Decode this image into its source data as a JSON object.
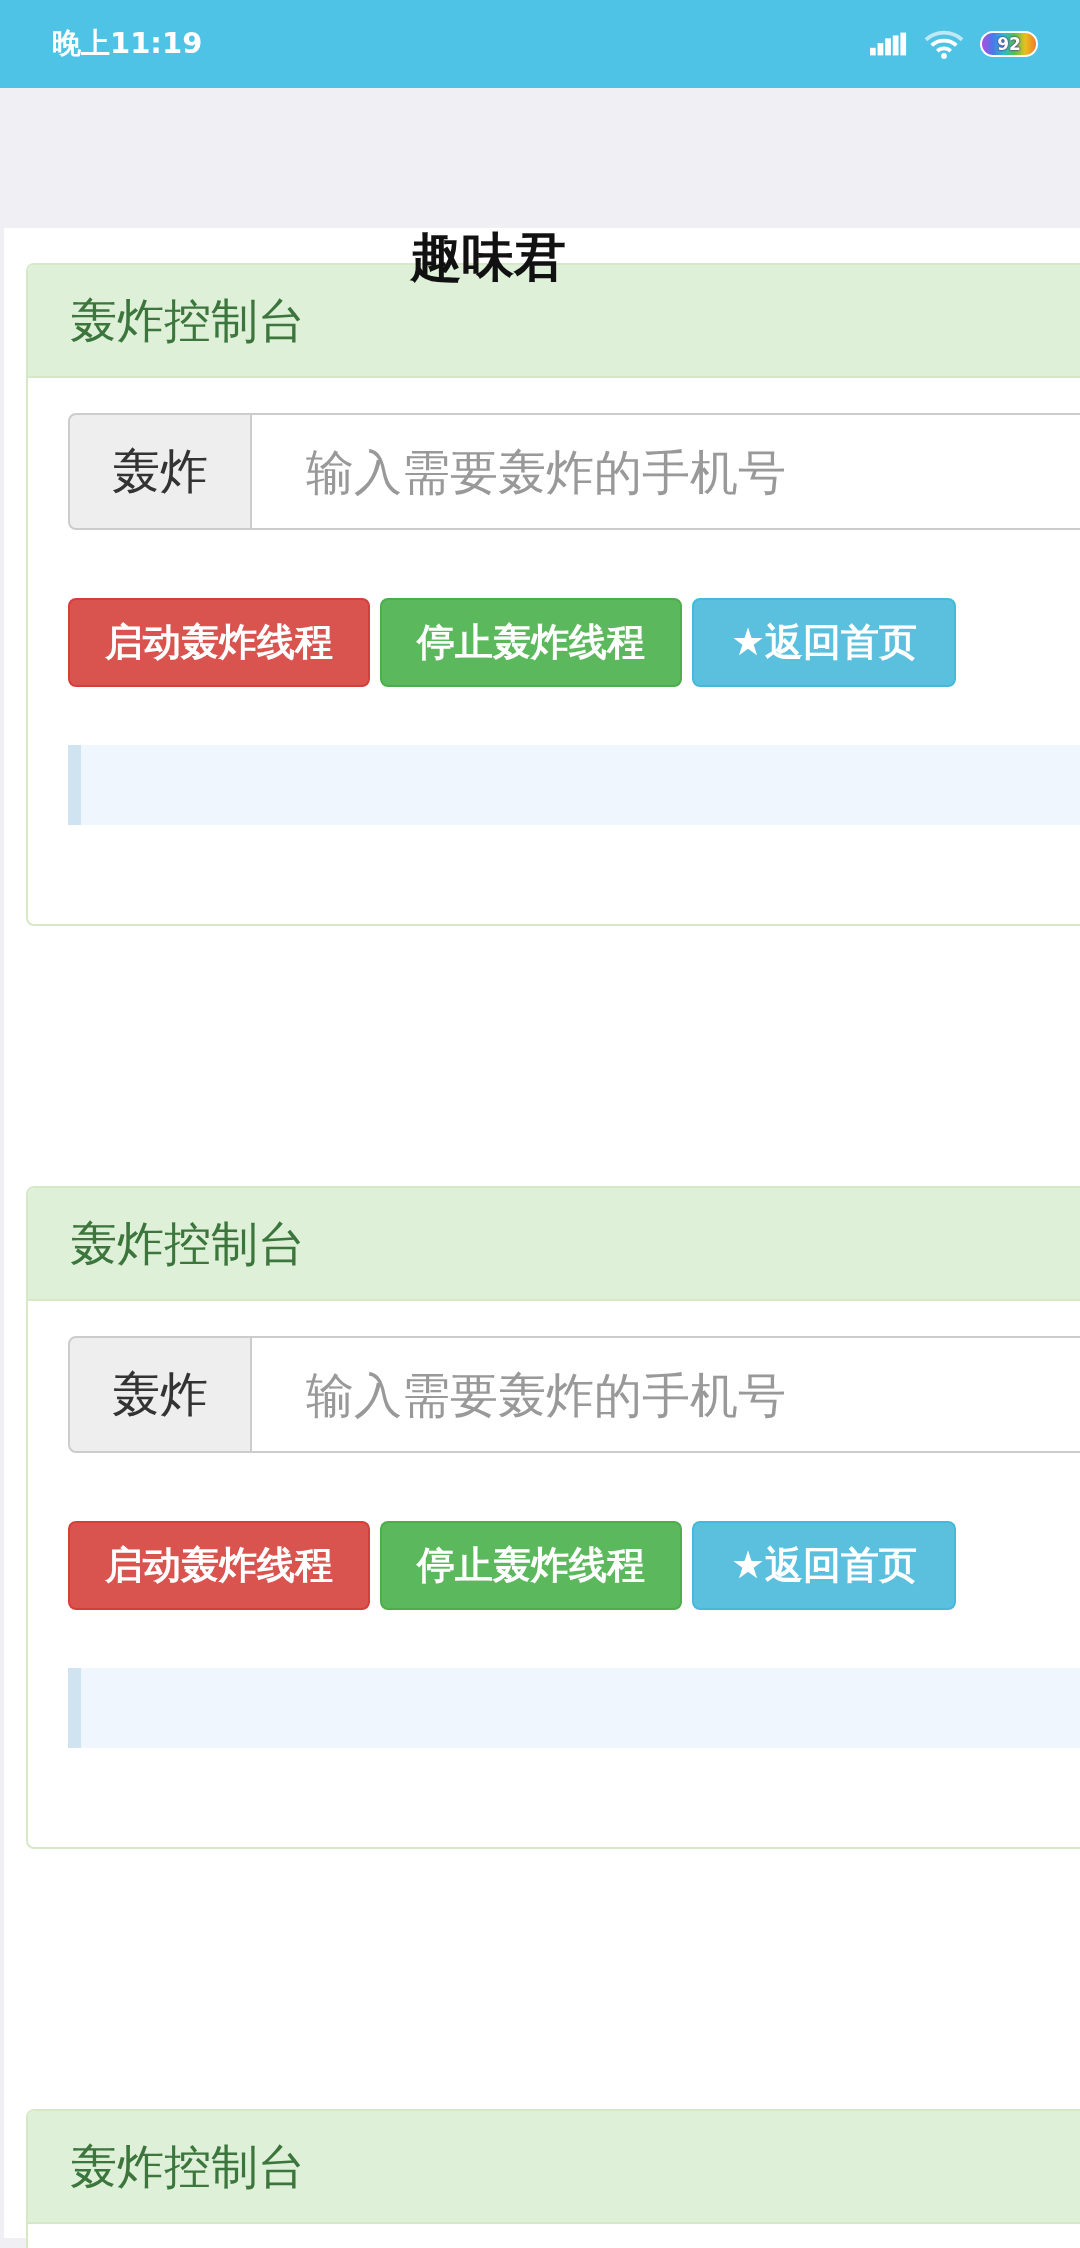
{
  "status_bar": {
    "time": "晚上11:19",
    "battery": "92"
  },
  "page": {
    "title": "趣味君"
  },
  "cards": [
    {
      "header": "轰炸控制台",
      "input": {
        "addon": "轰炸",
        "placeholder": "输入需要轰炸的手机号"
      },
      "buttons": [
        {
          "kind": "start",
          "label": "启动轰炸线程"
        },
        {
          "kind": "stop",
          "label": "停止轰炸线程"
        },
        {
          "kind": "home",
          "label": "★返回首页"
        }
      ],
      "output_box": true
    },
    {
      "header": "轰炸控制台",
      "input": {
        "addon": "轰炸",
        "placeholder": "输入需要轰炸的手机号"
      },
      "buttons": [
        {
          "kind": "start",
          "label": "启动轰炸线程"
        },
        {
          "kind": "stop",
          "label": "停止轰炸线程"
        },
        {
          "kind": "home",
          "label": "★返回首页"
        }
      ],
      "output_box": true
    },
    {
      "header": "轰炸控制台"
    }
  ]
}
